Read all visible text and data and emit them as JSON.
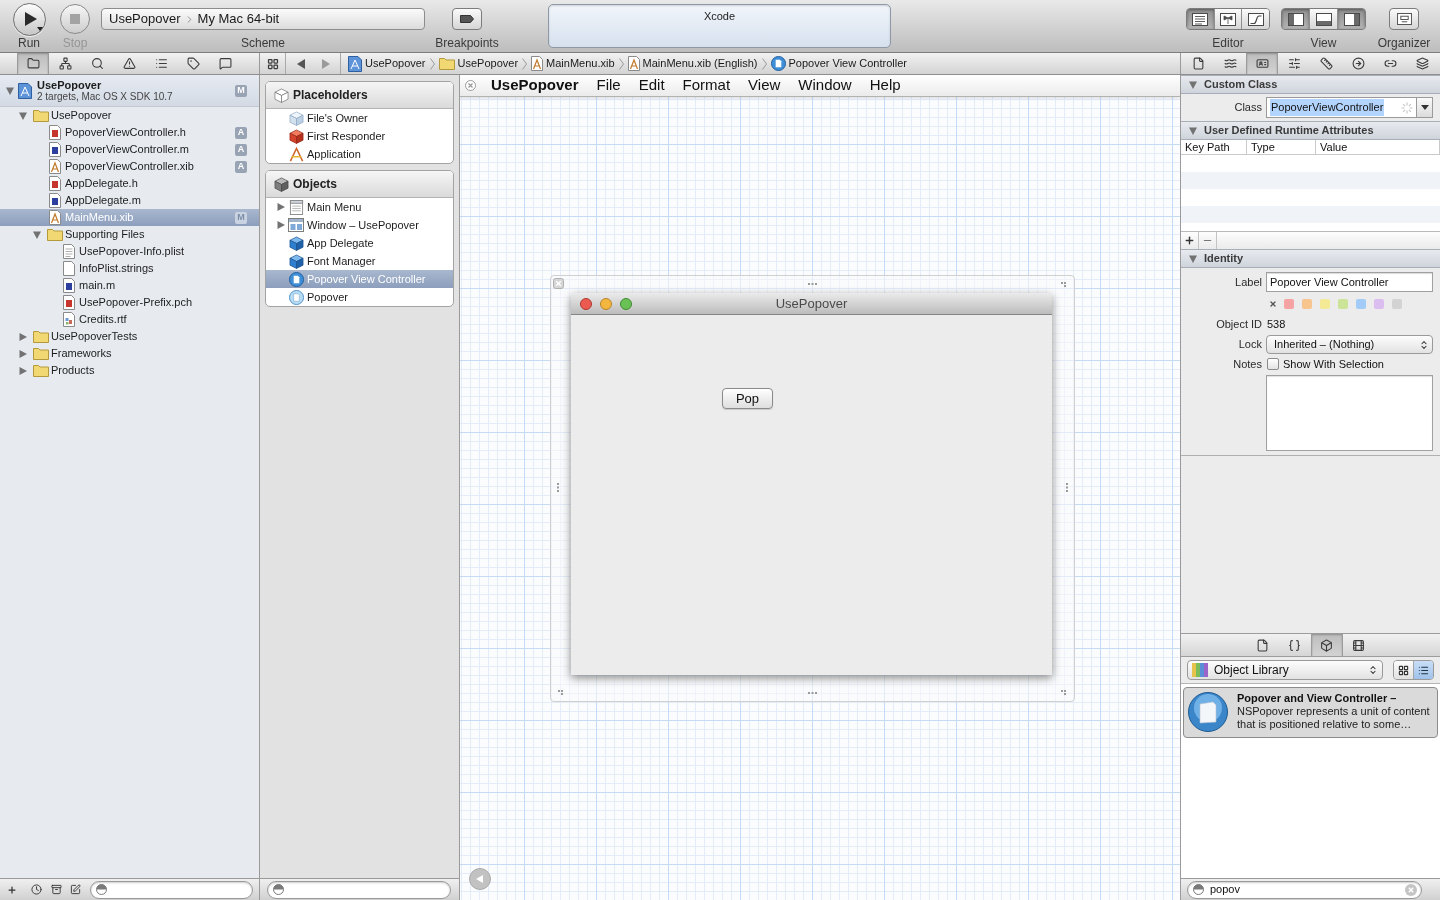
{
  "toolbar": {
    "run": {
      "label": "Run"
    },
    "stop": {
      "label": "Stop",
      "disabled": true
    },
    "scheme": {
      "target": "UsePopover",
      "destination": "My Mac 64-bit",
      "label": "Scheme"
    },
    "breakpoints": {
      "label": "Breakpoints"
    },
    "activity": {
      "title": "Xcode"
    },
    "editor": {
      "label": "Editor",
      "segments": [
        {
          "kind": "standard",
          "selected": true
        },
        {
          "kind": "assistant",
          "selected": false
        },
        {
          "kind": "version",
          "selected": false
        }
      ]
    },
    "view": {
      "label": "View",
      "segments": [
        {
          "kind": "navigator",
          "selected": true
        },
        {
          "kind": "debug",
          "selected": false
        },
        {
          "kind": "utilities",
          "selected": true
        }
      ]
    },
    "organizer": {
      "label": "Organizer"
    }
  },
  "navigator_tabs": [
    {
      "kind": "project",
      "selected": true
    },
    {
      "kind": "symbol",
      "selected": false
    },
    {
      "kind": "search",
      "selected": false
    },
    {
      "kind": "issue",
      "selected": false
    },
    {
      "kind": "debug",
      "selected": false
    },
    {
      "kind": "breakpoint",
      "selected": false
    },
    {
      "kind": "log",
      "selected": false
    }
  ],
  "jump_bar": {
    "path": [
      {
        "kind": "project",
        "label": "UsePopover"
      },
      {
        "kind": "folder",
        "label": "UsePopover"
      },
      {
        "kind": "xib",
        "label": "MainMenu.xib"
      },
      {
        "kind": "xib",
        "label": "MainMenu.xib (English)"
      },
      {
        "kind": "controller",
        "label": "Popover View Controller"
      }
    ]
  },
  "inspector_tabs": [
    {
      "kind": "file",
      "selected": false
    },
    {
      "kind": "help",
      "selected": false
    },
    {
      "kind": "identity",
      "selected": true
    },
    {
      "kind": "attributes",
      "selected": false
    },
    {
      "kind": "size",
      "selected": false
    },
    {
      "kind": "connections",
      "selected": false
    },
    {
      "kind": "bindings",
      "selected": false
    },
    {
      "kind": "effects",
      "selected": false
    }
  ],
  "navigator": {
    "project": {
      "name": "UsePopover",
      "subtitle": "2 targets, Mac OS X SDK 10.7",
      "badge": "M",
      "expanded": true,
      "selected": false,
      "children": [
        {
          "kind": "folder",
          "name": "UsePopover",
          "expanded": true,
          "selected": false,
          "children": [
            {
              "kind": "h",
              "name": "PopoverViewController.h",
              "badge": "A",
              "selected": false
            },
            {
              "kind": "m",
              "name": "PopoverViewController.m",
              "badge": "A",
              "selected": false
            },
            {
              "kind": "xib",
              "name": "PopoverViewController.xib",
              "badge": "A",
              "selected": false
            },
            {
              "kind": "h",
              "name": "AppDelegate.h",
              "selected": false
            },
            {
              "kind": "m",
              "name": "AppDelegate.m",
              "selected": false
            },
            {
              "kind": "xib",
              "name": "MainMenu.xib",
              "badge": "M",
              "selected": true
            },
            {
              "kind": "folder",
              "name": "Supporting Files",
              "expanded": true,
              "selected": false,
              "children": [
                {
                  "kind": "plist",
                  "name": "UsePopover-Info.plist",
                  "selected": false
                },
                {
                  "kind": "strings",
                  "name": "InfoPlist.strings",
                  "selected": false
                },
                {
                  "kind": "m",
                  "name": "main.m",
                  "selected": false
                },
                {
                  "kind": "h",
                  "name": "UsePopover-Prefix.pch",
                  "selected": false
                },
                {
                  "kind": "rtf",
                  "name": "Credits.rtf",
                  "selected": false
                }
              ]
            }
          ]
        },
        {
          "kind": "folder",
          "name": "UsePopoverTests",
          "expanded": false,
          "selected": false
        },
        {
          "kind": "folder",
          "name": "Frameworks",
          "expanded": false,
          "selected": false
        },
        {
          "kind": "folder",
          "name": "Products",
          "expanded": false,
          "selected": false
        }
      ]
    }
  },
  "outline": {
    "sections": [
      {
        "kind": "placeholders",
        "title": "Placeholders",
        "items": [
          {
            "kind": "owner",
            "label": "File's Owner",
            "selected": false
          },
          {
            "kind": "responder",
            "label": "First Responder",
            "selected": false
          },
          {
            "kind": "application",
            "label": "Application",
            "selected": false
          }
        ]
      },
      {
        "kind": "objects",
        "title": "Objects",
        "items": [
          {
            "kind": "menu",
            "label": "Main Menu",
            "expanded": false,
            "selected": false
          },
          {
            "kind": "window",
            "label": "Window – UsePopover",
            "expanded": false,
            "selected": false
          },
          {
            "kind": "object",
            "label": "App Delegate",
            "selected": false
          },
          {
            "kind": "object",
            "label": "Font Manager",
            "selected": false
          },
          {
            "kind": "controller",
            "label": "Popover View Controller",
            "selected": true
          },
          {
            "kind": "popover",
            "label": "Popover",
            "selected": false
          }
        ]
      }
    ]
  },
  "canvas": {
    "menu_bar": {
      "app": "UsePopover",
      "items": [
        "File",
        "Edit",
        "Format",
        "View",
        "Window",
        "Help"
      ]
    },
    "window": {
      "title": "UsePopover",
      "button": "Pop"
    }
  },
  "inspector": {
    "custom_class": {
      "title": "Custom Class",
      "expanded": true,
      "class_label": "Class",
      "class_value": "PopoverViewController"
    },
    "runtime_attributes": {
      "title": "User Defined Runtime Attributes",
      "expanded": true,
      "columns": [
        "Key Path",
        "Type",
        "Value"
      ]
    },
    "identity": {
      "title": "Identity",
      "expanded": true,
      "label_label": "Label",
      "label_value": "Popover View Controller",
      "label_colors": [
        {
          "color": "#f7a3a3"
        },
        {
          "color": "#f9c58f"
        },
        {
          "color": "#f4ea96"
        },
        {
          "color": "#cbe497"
        },
        {
          "color": "#a2ccf7"
        },
        {
          "color": "#dcbdef"
        },
        {
          "color": "#d3d3d3"
        }
      ],
      "object_id_label": "Object ID",
      "object_id": "538",
      "lock_label": "Lock",
      "lock_value": "Inherited – (Nothing)",
      "notes_label": "Notes",
      "show_with_selection": {
        "label": "Show With Selection",
        "checked": false
      }
    }
  },
  "library": {
    "tabs": [
      {
        "kind": "file",
        "selected": false
      },
      {
        "kind": "code",
        "selected": false
      },
      {
        "kind": "object",
        "selected": true
      },
      {
        "kind": "media",
        "selected": false
      }
    ],
    "picker": "Object Library",
    "view_modes": [
      {
        "kind": "grid",
        "selected": false
      },
      {
        "kind": "list",
        "selected": true
      }
    ],
    "items": [
      {
        "title": "Popover and View Controller –",
        "description": "NSPopover represents a unit of content that is positioned relative to some…",
        "selected": true
      }
    ],
    "search": {
      "value": "popov"
    }
  }
}
